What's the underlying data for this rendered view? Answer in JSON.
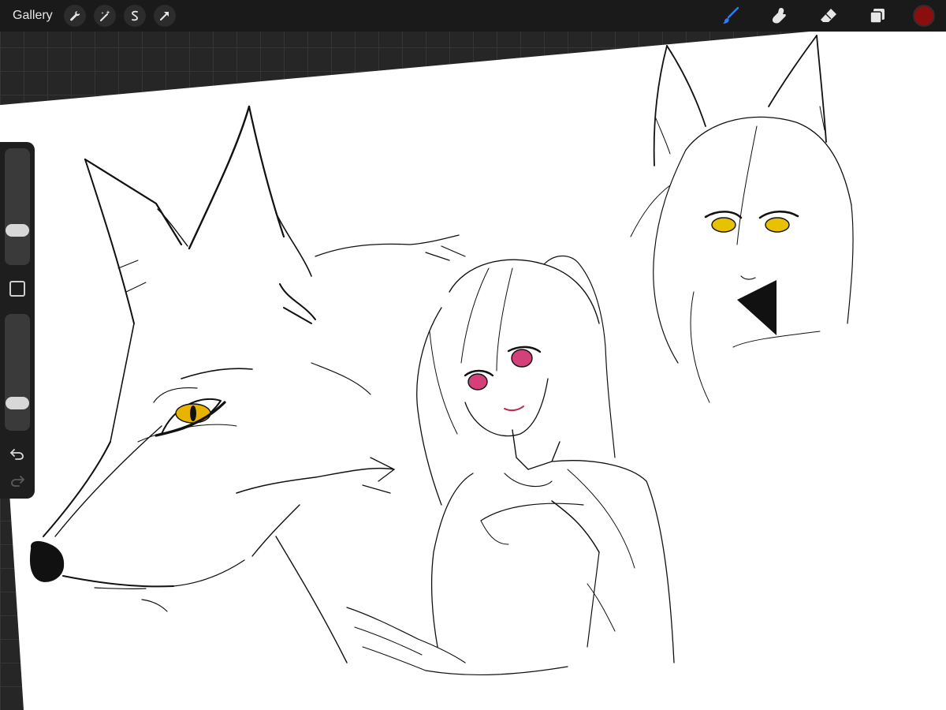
{
  "toolbar": {
    "gallery_label": "Gallery",
    "left_tools": [
      {
        "name": "wrench-icon"
      },
      {
        "name": "magic-wand-icon"
      },
      {
        "name": "selection-icon"
      },
      {
        "name": "transform-arrow-icon"
      }
    ],
    "right_tools": [
      {
        "name": "brush-icon",
        "active": true
      },
      {
        "name": "smudge-icon"
      },
      {
        "name": "eraser-icon"
      },
      {
        "name": "layers-icon"
      }
    ],
    "active_color": "#8b0e0e",
    "accent_color": "#2f7df6"
  },
  "sidebar": {
    "brush_size_level": 0.27,
    "opacity_level": 0.2
  },
  "colors": {
    "wolf_eye": "#e8b400",
    "girl_eye": "#d4407a",
    "fox_girl_eye": "#e8c200"
  }
}
